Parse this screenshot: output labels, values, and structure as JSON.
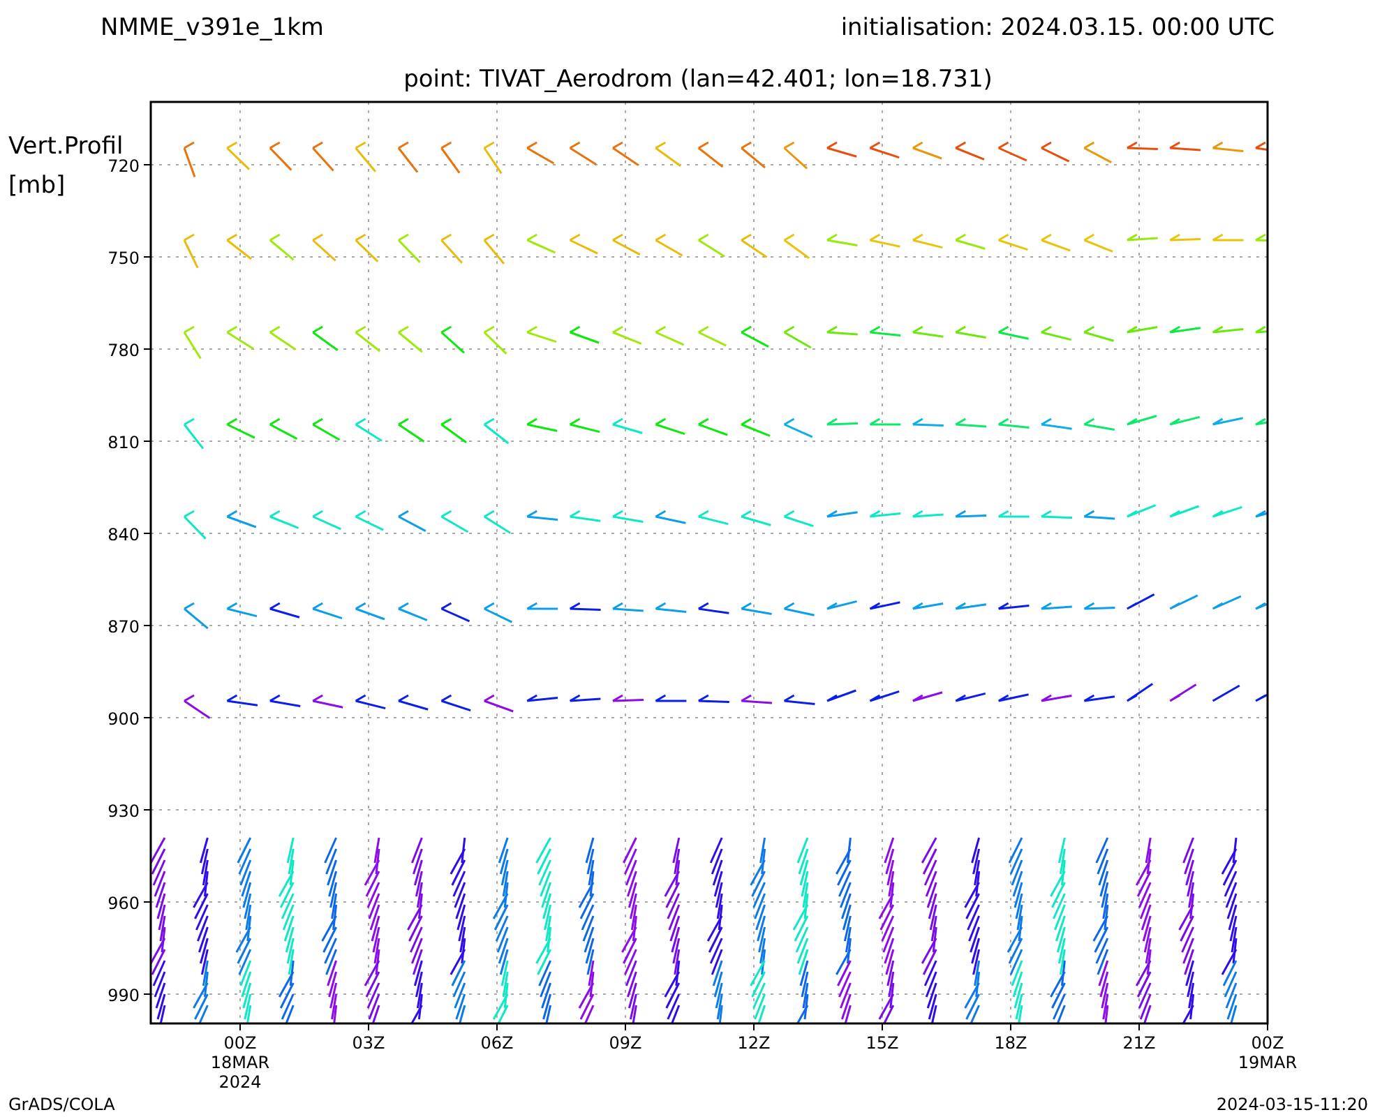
{
  "header": {
    "model": "NMME_v391e_1km",
    "initialisation": "initialisation: 2024.03.15. 00:00 UTC"
  },
  "title": "point: TIVAT_Aerodrom (lan=42.401; lon=18.731)",
  "y_axis": {
    "label_lines": [
      "Vert.Profil",
      "[mb]"
    ],
    "ticks": [
      "720",
      "750",
      "780",
      "810",
      "840",
      "870",
      "900",
      "930",
      "960",
      "990"
    ]
  },
  "x_axis": {
    "ticks": [
      {
        "label": "00Z",
        "sub": [
          "18MAR",
          "2024"
        ]
      },
      {
        "label": "03Z"
      },
      {
        "label": "06Z"
      },
      {
        "label": "09Z"
      },
      {
        "label": "12Z"
      },
      {
        "label": "15Z"
      },
      {
        "label": "18Z"
      },
      {
        "label": "21Z"
      },
      {
        "label": "00Z",
        "sub": [
          "19MAR"
        ]
      }
    ]
  },
  "footer": {
    "left": "GrADS/COLA",
    "right": "2024-03-15-11:20"
  }
}
